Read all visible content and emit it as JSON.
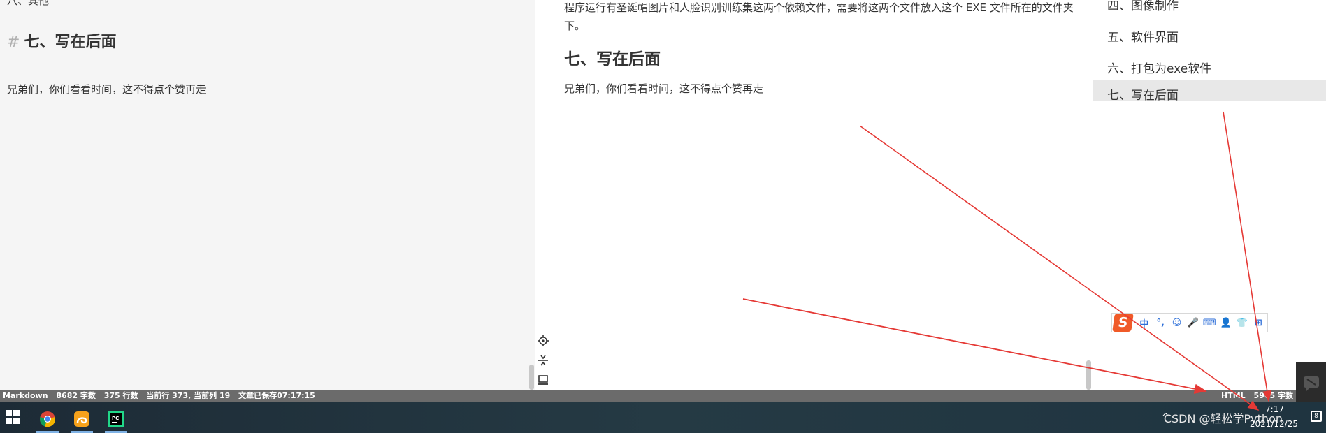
{
  "editor": {
    "cut_line": "八、其他",
    "heading_hash": "#",
    "heading": "七、写在后面",
    "paragraph": "兄弟们，你们看看时间，这不得点个赞再走"
  },
  "preview": {
    "paragraph1": "程序运行有圣诞帽图片和人脸识别训练集这两个依赖文件，需要将这两个文件放入这个 EXE 文件所在的文件夹下。",
    "heading": "七、写在后面",
    "paragraph2": "兄弟们，你们看看时间，这不得点个赞再走",
    "tools": [
      "locate-icon",
      "sync-scroll-icon",
      "layout-icon"
    ]
  },
  "toc": {
    "items": [
      {
        "label": "四、图像制作",
        "active": false
      },
      {
        "label": "五、软件界面",
        "active": false
      },
      {
        "label": "六、打包为exe软件",
        "active": false
      },
      {
        "label": "七、写在后面",
        "active": true
      }
    ]
  },
  "ime": {
    "logo": "S",
    "buttons": [
      "中",
      "°,",
      "☺",
      "🎤",
      "⌨",
      "👤",
      "👕",
      "⊞"
    ]
  },
  "statusbar": {
    "mode": "Markdown",
    "words": "8682 字数",
    "lines": "375 行数",
    "cursor": "当前行 373, 当前列 19",
    "saved": "文章已保存07:17:15",
    "right_mode": "HTML",
    "right_words": "5965 字数"
  },
  "taskbar": {
    "apps": [
      {
        "name": "chrome-icon",
        "color": "#4285f4"
      },
      {
        "name": "uc-browser-icon",
        "color": "#f7a21b"
      },
      {
        "name": "pycharm-icon",
        "color": "#21d789"
      }
    ],
    "tray_caret": "^",
    "tray_text": "CSDN @轻松学Python",
    "clock_time": "7:17",
    "clock_date": "2021/12/25",
    "notifications": "8"
  },
  "colors": {
    "arrow": "#e53935",
    "accent_ime": "#f05a28"
  }
}
